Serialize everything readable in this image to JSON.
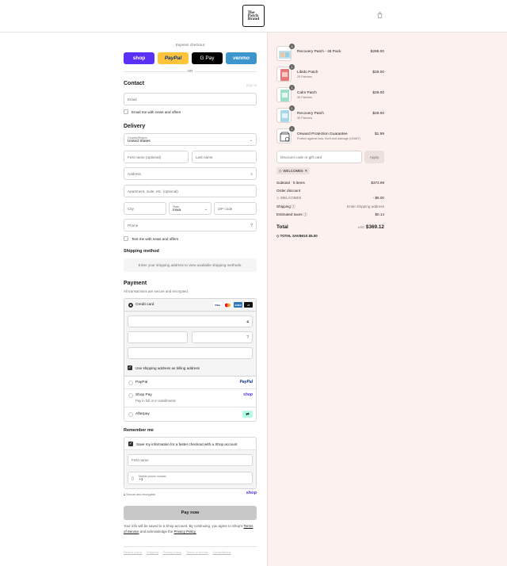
{
  "brand": {
    "logo_text": "The\nPatch\nBrand"
  },
  "express": {
    "label": "Express checkout",
    "buttons": [
      "shop",
      "PayPal",
      "G Pay",
      "venmo"
    ],
    "or": "OR"
  },
  "contact": {
    "title": "Contact",
    "sign_in": "Sign in",
    "email_placeholder": "Email",
    "news_label": "Email me with news and offers"
  },
  "delivery": {
    "title": "Delivery",
    "country_label": "Country/Region",
    "country_value": "United States",
    "first_name": "First name (optional)",
    "last_name": "Last name",
    "address": "Address",
    "apartment": "Apartment, suite, etc. (optional)",
    "city": "City",
    "state_label": "State",
    "state_value": "Iowa",
    "zip": "ZIP code",
    "phone": "Phone",
    "text_label": "Text me with news and offers"
  },
  "shipping": {
    "title": "Shipping method",
    "note": "Enter your shipping address to view available shipping methods."
  },
  "payment": {
    "title": "Payment",
    "subtitle": "All transactions are secure and encrypted.",
    "credit_card": "Credit card",
    "card_brands": [
      "VISA",
      "MC",
      "AMEX",
      "+5"
    ],
    "billing_label": "Use shipping address as billing address",
    "paypal": "PayPal",
    "paypal_logo": "PayPal",
    "shop_pay": "Shop Pay",
    "shop_pay_sub": "Pay in full or in installments",
    "shop_logo": "shop",
    "afterpay": "Afterpay"
  },
  "remember": {
    "title": "Remember me",
    "save_label": "Save my information for a faster checkout with a Shop account",
    "first_name": "First name",
    "mobile_label": "Mobile phone number",
    "mobile_value": "+1",
    "secure": "Secure and encrypted",
    "shop_logo": "shop"
  },
  "pay_now": "Pay now",
  "legal": {
    "text1": "Your info will be saved to a Shop account. By continuing, you agree to Shop's",
    "terms": "Terms of Service",
    "text2": "and acknowledge the",
    "privacy": "Privacy Policy."
  },
  "footer_links": [
    "Refund policy",
    "Shipping",
    "Privacy policy",
    "Terms of service",
    "Cancellations"
  ],
  "cart": {
    "items": [
      {
        "name": "Recovery Patch - 48 Pack",
        "sub": "",
        "price": "$288.00",
        "qty": "4"
      },
      {
        "name": "Libido Patch",
        "sub": "20 Patches",
        "price": "$28.00",
        "qty": "1"
      },
      {
        "name": "Calm Patch",
        "sub": "30 Patches",
        "price": "$28.00",
        "qty": "1"
      },
      {
        "name": "Recovery Patch",
        "sub": "30 Patches",
        "price": "$28.00",
        "qty": "1"
      },
      {
        "name": "Onward Protection Guarantee",
        "sub": "Protect against loss, theft and damage (ONWT)",
        "price": "$1.99",
        "qty": "1"
      }
    ],
    "discount_placeholder": "Discount code or gift card",
    "apply": "Apply",
    "code": "WELCOME5",
    "subtotal_label": "Subtotal · 5 items",
    "subtotal": "$373.99",
    "order_discount": "Order discount",
    "discount_code": "WELCOME5",
    "discount_value": "- $5.00",
    "shipping_label": "Shipping",
    "shipping_value": "Enter shipping address",
    "taxes_label": "Estimated taxes",
    "taxes_value": "$0.14",
    "total_label": "Total",
    "currency": "USD",
    "total": "$369.12",
    "savings_label": "TOTAL SAVINGS",
    "savings": "$5.00"
  }
}
